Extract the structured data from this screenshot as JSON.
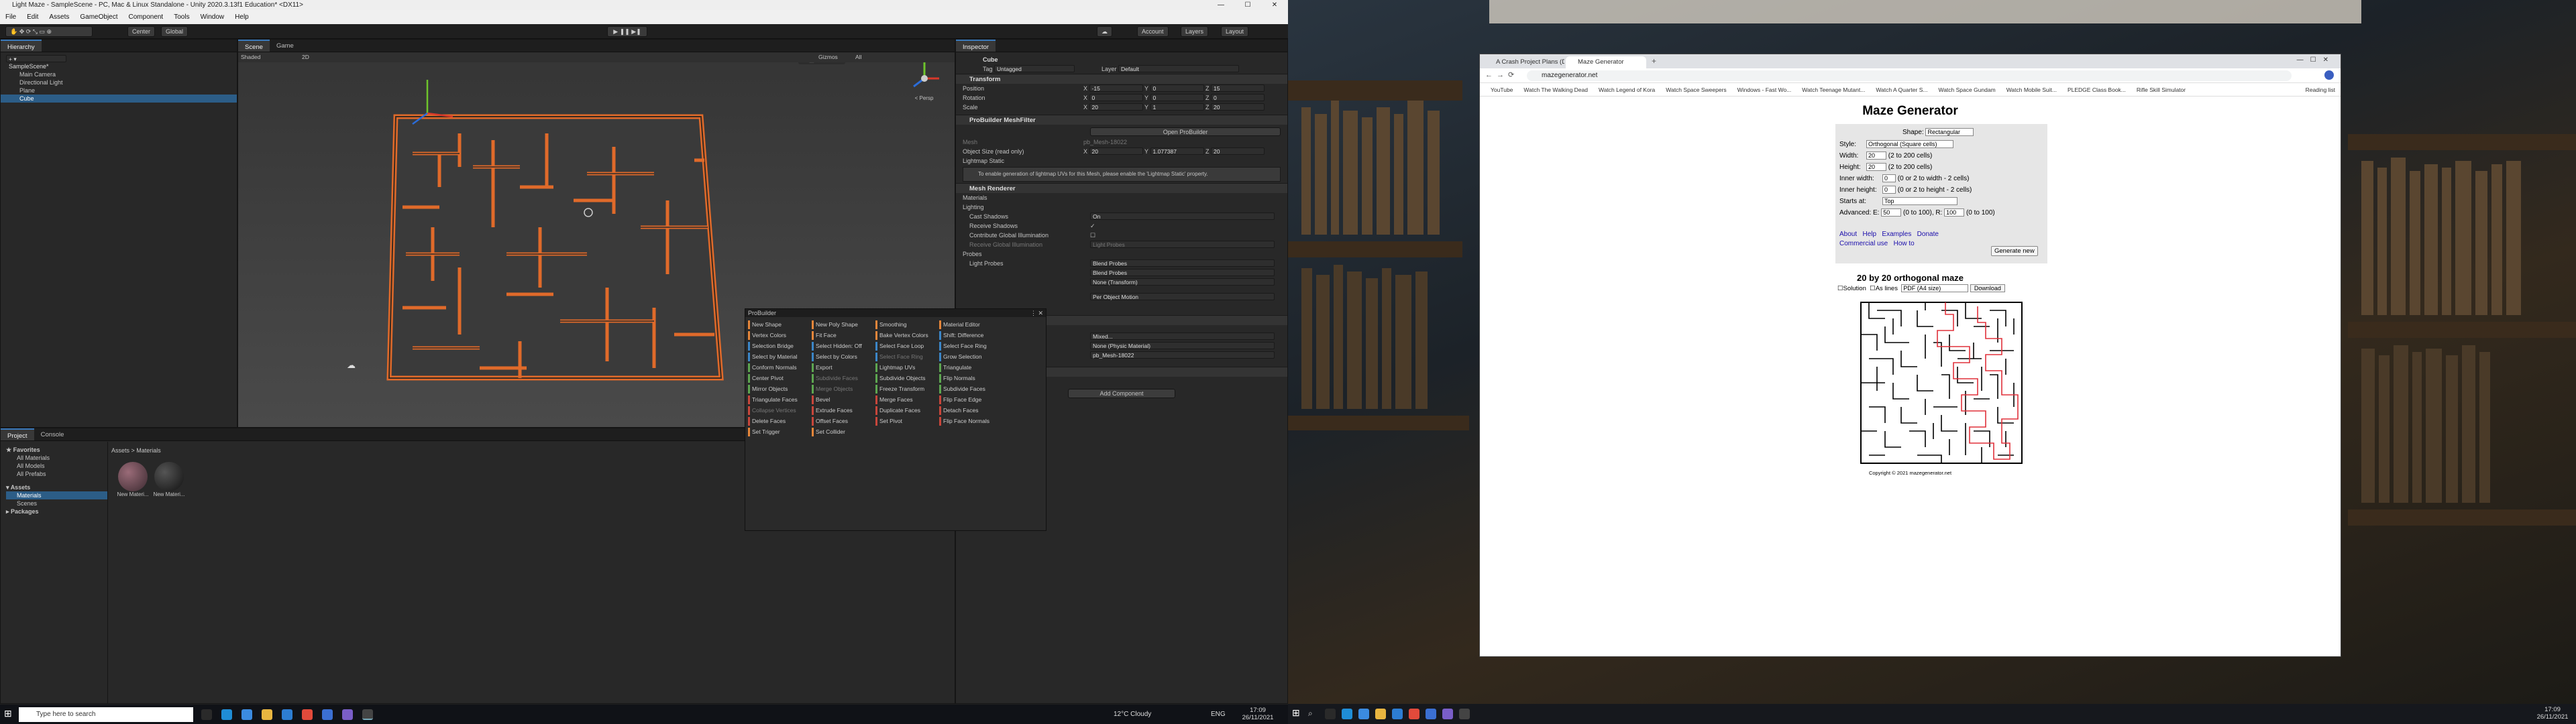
{
  "unity": {
    "title": "Light Maze - SampleScene - PC, Mac & Linux Standalone - Unity 2020.3.13f1 Education* <DX11>",
    "window_controls": [
      "—",
      "☐",
      "✕"
    ],
    "menu": [
      "File",
      "Edit",
      "Assets",
      "GameObject",
      "Component",
      "Tools",
      "Window",
      "Help"
    ],
    "toolbar": {
      "center": "Center",
      "global": "Global",
      "account": "Account",
      "layers": "Layers",
      "layout": "Layout"
    },
    "hierarchy": {
      "tab": "Hierarchy",
      "items": [
        "SampleScene*",
        "Main Camera",
        "Directional Light",
        "Plane",
        "Cube"
      ]
    },
    "scene": {
      "tabs": [
        "Scene",
        "Game"
      ],
      "shading": "Shaded",
      "mode": "2D",
      "gizmos": "Gizmos",
      "search": "All",
      "persp": "< Persp"
    },
    "probuilder": {
      "title": "ProBuilder",
      "col1": [
        "New Shape",
        "Vertex Colors",
        "Selection Bridge",
        "Select by Material",
        "Conform Normals",
        "Center Pivot",
        "Mirror Objects",
        "Triangulate Faces",
        "Collapse Vertices",
        "Delete Faces",
        "Set Trigger"
      ],
      "col2": [
        "New Poly Shape",
        "Fit Face",
        "Select Hidden: Off",
        "Select by Colors",
        "Export",
        "Subdivide Faces",
        "Merge Objects",
        "Bevel",
        "Extrude Faces",
        "Offset Faces",
        "Set Collider"
      ],
      "col3": [
        "Smoothing",
        "Bake Vertex Colors",
        "Select Face Loop",
        "Select Face Ring",
        "Lightmap UVs",
        "Subdivide Objects",
        "Freeze Transform",
        "Merge Faces",
        "Duplicate Faces",
        "Set Pivot",
        ""
      ],
      "col4": [
        "Material Editor",
        "Shift: Difference",
        "Select Face Ring",
        "Grow Selection",
        "Triangulate",
        "Flip Normals",
        "Subdivide Faces",
        "Flip Face Edge",
        "Detach Faces",
        "Flip Face Normals",
        ""
      ]
    },
    "inspector": {
      "tab": "Inspector",
      "object": "Cube",
      "tag": "Untagged",
      "layer": "Default",
      "transform": "Transform",
      "position": {
        "label": "Position",
        "x": "-15",
        "y": "0",
        "z": "15"
      },
      "rotation": {
        "label": "Rotation",
        "x": "0",
        "y": "0",
        "z": "0"
      },
      "scale": {
        "label": "Scale",
        "x": "20",
        "y": "1",
        "z": "20"
      },
      "pbmesh": "ProBuilder MeshFilter",
      "open": "Open ProBuilder",
      "mesh": "pb_Mesh-18022",
      "object_size": "Object Size (read only)",
      "size": {
        "x": "20",
        "y": "1.077387",
        "z": "20"
      },
      "lightmap_static": "Lightmap Static",
      "note": "To enable generation of lightmap UVs for this Mesh, please enable the 'Lightmap Static' property.",
      "renderer": "Mesh Renderer",
      "materials": "Materials",
      "lighting": "Lighting",
      "cast": "Cast Shadows",
      "cast_val": "On",
      "receive": "Receive Shadows",
      "contribute": "Contribute Global Illumination",
      "receive_gi": "Receive Global Illumination",
      "receive_gi_val": "Light Probes",
      "probes": "Probes",
      "light_probes": "Light Probes",
      "light_probes_val": "Blend Probes",
      "reflection": "Blend Probes",
      "anchor": "None (Transform)",
      "motion": "Per Object Motion",
      "mesh_collider": "Mixed...",
      "physics_mat": "None (Physic Material)",
      "mesh_name": "pb_Mesh-18022",
      "add_component": "Add Component"
    },
    "project": {
      "tabs": [
        "Project",
        "Console"
      ],
      "favorites": "Favorites",
      "fav_items": [
        "All Materials",
        "All Models",
        "All Prefabs"
      ],
      "assets": "Assets",
      "asset_items": [
        "Materials",
        "Scenes"
      ],
      "packages": "Packages",
      "breadcrumb": "Assets > Materials",
      "files": [
        "New Materi...",
        "New Materi..."
      ]
    }
  },
  "taskbar_left": {
    "search": "Type here to search",
    "weather": "12°C  Cloudy",
    "lang": "ENG",
    "time": "17:09",
    "date": "26/11/2021"
  },
  "chrome": {
    "tabs": [
      "A Crash Project Plans (Drive)",
      "Maze Generator"
    ],
    "url": "mazegenerator.net",
    "bookmarks": [
      "YouTube",
      "Watch The Walking Dead",
      "Watch Legend of Kora",
      "Watch Space Sweepers",
      "Windows - Fast Wo...",
      "Watch Teenage Mutant...",
      "Watch A Quarter S...",
      "Watch Space Gundam",
      "Watch Mobile Suit...",
      "PLEDGE Class Book...",
      "Rifle Skill Simulator",
      "Reading list"
    ]
  },
  "maze": {
    "heading": "Maze Generator",
    "shape_label": "Shape:",
    "shape": "Rectangular",
    "style_label": "Style:",
    "style": "Orthogonal (Square cells)",
    "width_label": "Width:",
    "width": "20",
    "width_hint": "(2 to 200 cells)",
    "height_label": "Height:",
    "height": "20",
    "height_hint": "(2 to 200 cells)",
    "inner_w_label": "Inner width:",
    "inner_w": "0",
    "inner_w_hint": "(0 or 2 to width - 2 cells)",
    "inner_h_label": "Inner height:",
    "inner_h": "0",
    "inner_h_hint": "(0 or 2 to height - 2 cells)",
    "starts_label": "Starts at:",
    "starts": "Top",
    "adv_label": "Advanced:",
    "e_label": "E:",
    "e": "50",
    "e_hint": "(0 to 100),",
    "r_label": "R:",
    "r": "100",
    "r_hint": "(0 to 100)",
    "links": [
      "About",
      "Help",
      "Examples",
      "Donate"
    ],
    "links2": [
      "Commercial use",
      "How to"
    ],
    "generate": "Generate new",
    "result_title": "20 by 20 orthogonal maze",
    "solution": "Solution",
    "as_lines": "As lines",
    "format": "PDF (A4 size)",
    "download": "Download",
    "copyright": "Copyright © 2021 mazegenerator.net"
  },
  "taskbar_right": {
    "time": "17:09",
    "date": "26/11/2021"
  }
}
